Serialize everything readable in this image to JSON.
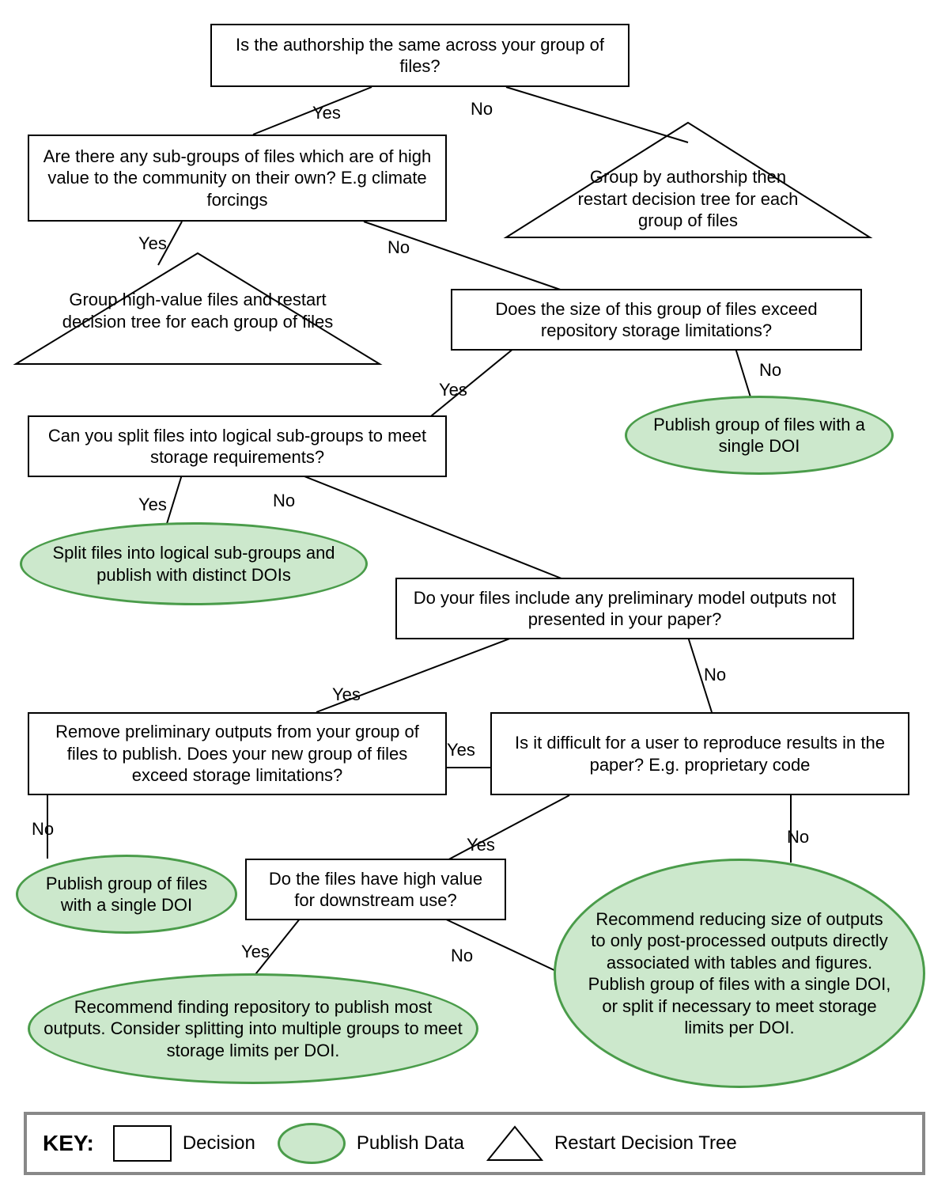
{
  "nodes": {
    "q_authorship": "Is the authorship the same across your group of files?",
    "q_subgroups": "Are there any sub-groups of files which are of high value to the community on their own? E.g climate forcings",
    "tri_group_auth": "Group by authorship then restart decision tree for each group of files",
    "tri_group_highvalue": "Group high-value files and restart decision tree for each group of files",
    "q_size_exceed": "Does the size of this group of files exceed repository storage limitations?",
    "pub_single_doi_1": "Publish group of files with a single DOI",
    "q_split_logical": "Can you split files into logical sub-groups to meet storage requirements?",
    "pub_split_distinct": "Split files into logical sub-groups and publish with distinct DOIs",
    "q_prelim_outputs": "Do your files include any preliminary model outputs not presented in your paper?",
    "q_remove_prelim": "Remove preliminary outputs from your group of files to publish. Does your new group of files exceed storage limitations?",
    "q_reproduce": "Is it difficult for a user to reproduce results in the paper? E.g. proprietary code",
    "pub_single_doi_2": "Publish group of files with a single DOI",
    "q_high_value_downstream": "Do the files have high value for downstream use?",
    "pub_find_repo": "Recommend finding repository to publish most outputs. Consider splitting into multiple groups to meet storage limits per DOI.",
    "pub_reduce_size": "Recommend reducing size of outputs to only post-processed outputs directly associated with tables and figures. Publish group of files with a single DOI, or split if necessary to meet storage limits per DOI."
  },
  "edges": {
    "yes": "Yes",
    "no": "No"
  },
  "legend": {
    "key": "KEY:",
    "decision": "Decision",
    "publish": "Publish Data",
    "restart": "Restart Decision Tree"
  },
  "chart_data": {
    "type": "flowchart",
    "title": "",
    "shapes": {
      "rectangle": "Decision",
      "ellipse_green": "Publish Data",
      "triangle": "Restart Decision Tree"
    },
    "nodes": [
      {
        "id": "q_authorship",
        "shape": "rectangle",
        "text": "Is the authorship the same across your group of files?"
      },
      {
        "id": "q_subgroups",
        "shape": "rectangle",
        "text": "Are there any sub-groups of files which are of high value to the community on their own? E.g climate forcings"
      },
      {
        "id": "tri_group_auth",
        "shape": "triangle",
        "text": "Group by authorship then restart decision tree for each group of files"
      },
      {
        "id": "tri_group_highvalue",
        "shape": "triangle",
        "text": "Group high-value files and restart decision tree for each group of files"
      },
      {
        "id": "q_size_exceed",
        "shape": "rectangle",
        "text": "Does the size of this group of files exceed repository storage limitations?"
      },
      {
        "id": "pub_single_doi_1",
        "shape": "ellipse_green",
        "text": "Publish group of files with a single DOI"
      },
      {
        "id": "q_split_logical",
        "shape": "rectangle",
        "text": "Can you split files into logical sub-groups to meet storage requirements?"
      },
      {
        "id": "pub_split_distinct",
        "shape": "ellipse_green",
        "text": "Split files into logical sub-groups and publish with distinct DOIs"
      },
      {
        "id": "q_prelim_outputs",
        "shape": "rectangle",
        "text": "Do your files include any preliminary model outputs not presented in your paper?"
      },
      {
        "id": "q_remove_prelim",
        "shape": "rectangle",
        "text": "Remove preliminary outputs from your group of files to publish. Does your new group of files exceed storage limitations?"
      },
      {
        "id": "q_reproduce",
        "shape": "rectangle",
        "text": "Is it difficult for a user to reproduce results in the paper? E.g. proprietary code"
      },
      {
        "id": "pub_single_doi_2",
        "shape": "ellipse_green",
        "text": "Publish group of files with a single DOI"
      },
      {
        "id": "q_high_value_downstream",
        "shape": "rectangle",
        "text": "Do the files have high value for downstream use?"
      },
      {
        "id": "pub_find_repo",
        "shape": "ellipse_green",
        "text": "Recommend finding repository to publish most outputs. Consider splitting into multiple groups to meet storage limits per DOI."
      },
      {
        "id": "pub_reduce_size",
        "shape": "ellipse_green",
        "text": "Recommend reducing size of outputs to only post-processed outputs directly associated with tables and figures. Publish group of files with a single DOI, or split if necessary to meet storage limits per DOI."
      }
    ],
    "edges": [
      {
        "from": "q_authorship",
        "to": "q_subgroups",
        "label": "Yes"
      },
      {
        "from": "q_authorship",
        "to": "tri_group_auth",
        "label": "No"
      },
      {
        "from": "q_subgroups",
        "to": "tri_group_highvalue",
        "label": "Yes"
      },
      {
        "from": "q_subgroups",
        "to": "q_size_exceed",
        "label": "No"
      },
      {
        "from": "q_size_exceed",
        "to": "q_split_logical",
        "label": "Yes"
      },
      {
        "from": "q_size_exceed",
        "to": "pub_single_doi_1",
        "label": "No"
      },
      {
        "from": "q_split_logical",
        "to": "pub_split_distinct",
        "label": "Yes"
      },
      {
        "from": "q_split_logical",
        "to": "q_prelim_outputs",
        "label": "No"
      },
      {
        "from": "q_prelim_outputs",
        "to": "q_remove_prelim",
        "label": "Yes"
      },
      {
        "from": "q_prelim_outputs",
        "to": "q_reproduce",
        "label": "No"
      },
      {
        "from": "q_remove_prelim",
        "to": "pub_single_doi_2",
        "label": "No"
      },
      {
        "from": "q_remove_prelim",
        "to": "q_high_value_downstream",
        "label": "Yes"
      },
      {
        "from": "q_reproduce",
        "to": "q_high_value_downstream",
        "label": "Yes"
      },
      {
        "from": "q_reproduce",
        "to": "pub_reduce_size",
        "label": "No"
      },
      {
        "from": "q_high_value_downstream",
        "to": "pub_find_repo",
        "label": "Yes"
      },
      {
        "from": "q_high_value_downstream",
        "to": "pub_reduce_size",
        "label": "No"
      }
    ]
  }
}
